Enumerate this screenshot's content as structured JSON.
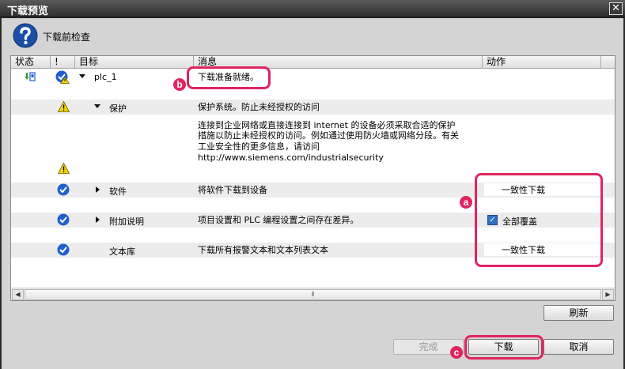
{
  "window": {
    "title": "下载预览",
    "close_glyph": "✕"
  },
  "header": {
    "label": "下载前检查",
    "icon": "question-icon"
  },
  "columns": {
    "status": "状态",
    "flag": "!",
    "target": "目标",
    "message": "消息",
    "action": "动作"
  },
  "rows": [
    {
      "target": "plc_1",
      "message": "下载准备就绪。",
      "status_icon": "connected-icon",
      "icon": "check-warn-icon",
      "expanded": true
    },
    {
      "target": "保护",
      "message": "保护系统。防止未经授权的访问",
      "icon": "warning-icon",
      "expanded": true
    },
    {
      "target": "",
      "message_lines": [
        "连接到企业网络或直接连接到 internet 的设备必须采取合适的保护",
        "措施以防止未经授权的访问。例如通过使用防火墙或网络分段。有关",
        "工业安全性的更多信息，请访问",
        "http://www.siemens.com/industrialsecurity"
      ],
      "icon": "warning-icon"
    },
    {
      "target": "软件",
      "message": "将软件下载到设备",
      "icon": "check-icon",
      "action": "一致性下载",
      "collapsed": true
    },
    {
      "target": "附加说明",
      "message": "项目设置和 PLC 编程设置之间存在差异。",
      "icon": "check-icon",
      "action": "全部覆盖",
      "action_checked": true,
      "collapsed": true
    },
    {
      "target": "文本库",
      "message": "下载所有报警文本和文本列表文本",
      "icon": "check-icon",
      "action": "一致性下载"
    }
  ],
  "buttons": {
    "refresh": "刷新",
    "finish": "完成",
    "download": "下载",
    "cancel": "取消"
  },
  "annotations": {
    "a": "a",
    "b": "b",
    "c": "c"
  },
  "colors": {
    "highlight": "#e0245e",
    "check_blue": "#1f5fcf",
    "warn_yellow": "#f5d400"
  }
}
